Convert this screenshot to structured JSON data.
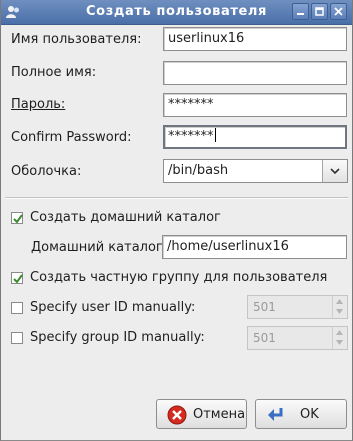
{
  "window": {
    "title": "Создать пользователя"
  },
  "form": {
    "username_label": "Имя пользователя:",
    "username_value": "userlinux16",
    "fullname_label": "Полное имя:",
    "fullname_value": "",
    "password_label": "Пароль:",
    "password_value": "*******",
    "confirm_label": "Confirm Password:",
    "confirm_value": "*******",
    "shell_label": "Оболочка:",
    "shell_value": "/bin/bash"
  },
  "options": {
    "create_home_label": "Создать домашний каталог",
    "create_home_checked": true,
    "home_dir_label": "Домашний каталог:",
    "home_dir_value": "/home/userlinux16",
    "private_group_label": "Создать частную группу для пользователя",
    "private_group_checked": true,
    "uid_label": "Specify user ID manually:",
    "uid_checked": false,
    "uid_value": "501",
    "gid_label": "Specify group ID manually:",
    "gid_checked": false,
    "gid_value": "501"
  },
  "buttons": {
    "cancel_label": "Отмена",
    "ok_label": "OK"
  },
  "colors": {
    "titlebar": "#4a6fa8",
    "check_green": "#3c8c2e",
    "cancel_red": "#d42a1f",
    "ok_blue": "#3b6fc4"
  }
}
